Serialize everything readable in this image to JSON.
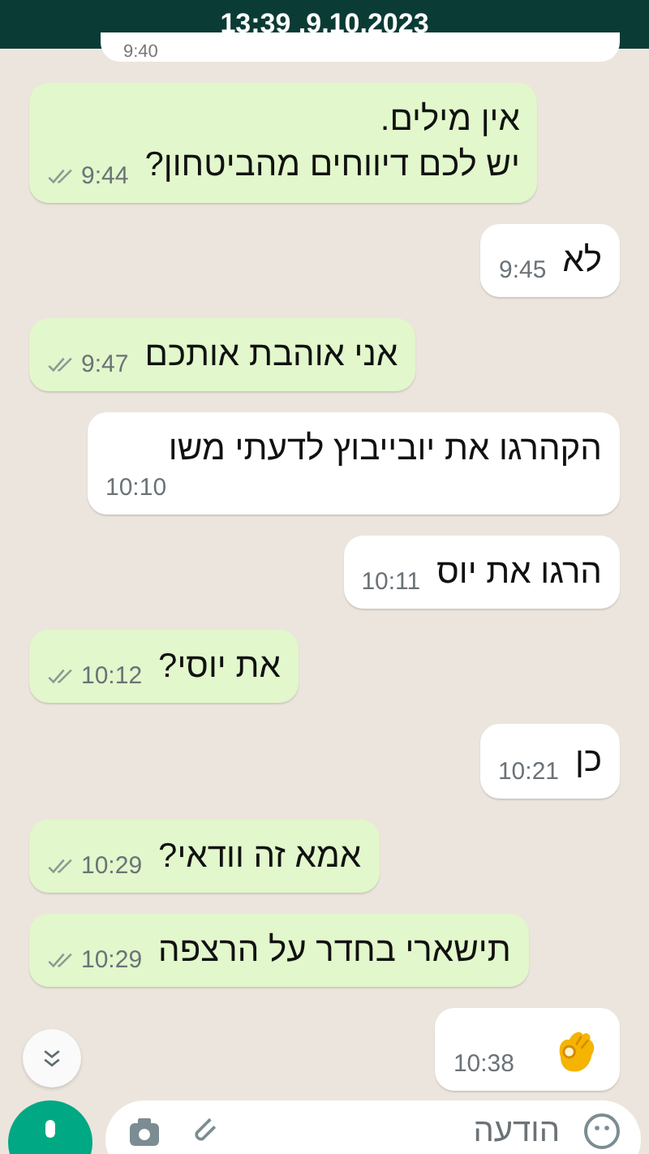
{
  "header": {
    "title": "13:39 ,9.10.2023"
  },
  "cut_message": {
    "time": "9:40"
  },
  "messages": [
    {
      "kind": "sent",
      "text": "אין מילים.\nיש לכם דיווחים מהביטחון?",
      "time": "9:44"
    },
    {
      "kind": "received",
      "text": "לא",
      "time": "9:45"
    },
    {
      "kind": "sent",
      "text": "אני אוהבת אותכם",
      "time": "9:47"
    },
    {
      "kind": "received",
      "text": "הקהרגו את יובייבוץ לדעתי משו",
      "time": "10:10"
    },
    {
      "kind": "received",
      "text": "הרגו את יוס",
      "time": "10:11"
    },
    {
      "kind": "sent",
      "text": "את יוסי?",
      "time": "10:12"
    },
    {
      "kind": "received",
      "text": "כן",
      "time": "10:21"
    },
    {
      "kind": "sent",
      "text": "אמא זה וודאי?",
      "time": "10:29"
    },
    {
      "kind": "sent",
      "text": "תישארי בחדר על הרצפה",
      "time": "10:29"
    },
    {
      "kind": "received",
      "time": "10:38"
    }
  ],
  "composer": {
    "placeholder": "הודעה"
  }
}
